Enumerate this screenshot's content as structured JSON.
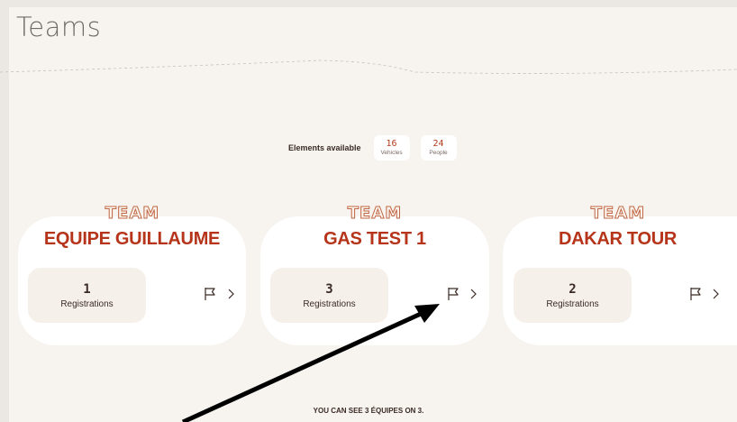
{
  "page": {
    "title": "Teams"
  },
  "available": {
    "label": "Elements available",
    "vehicles": {
      "value": "16",
      "label": "Vehicles"
    },
    "people": {
      "value": "24",
      "label": "People"
    }
  },
  "teams": [
    {
      "tag": "TEAM",
      "name": "EQUIPE GUILLAUME",
      "registrations": "1",
      "registrations_label": "Registrations"
    },
    {
      "tag": "TEAM",
      "name": "GAS TEST 1",
      "registrations": "3",
      "registrations_label": "Registrations"
    },
    {
      "tag": "TEAM",
      "name": "DAKAR TOUR",
      "registrations": "2",
      "registrations_label": "Registrations"
    }
  ],
  "footer": {
    "note": "YOU CAN SEE 3 ÉQUIPES ON 3."
  },
  "colors": {
    "accent": "#b5341a",
    "background": "#f7f4ef",
    "card": "#ffffff",
    "registration_box": "#f6f0ea"
  }
}
